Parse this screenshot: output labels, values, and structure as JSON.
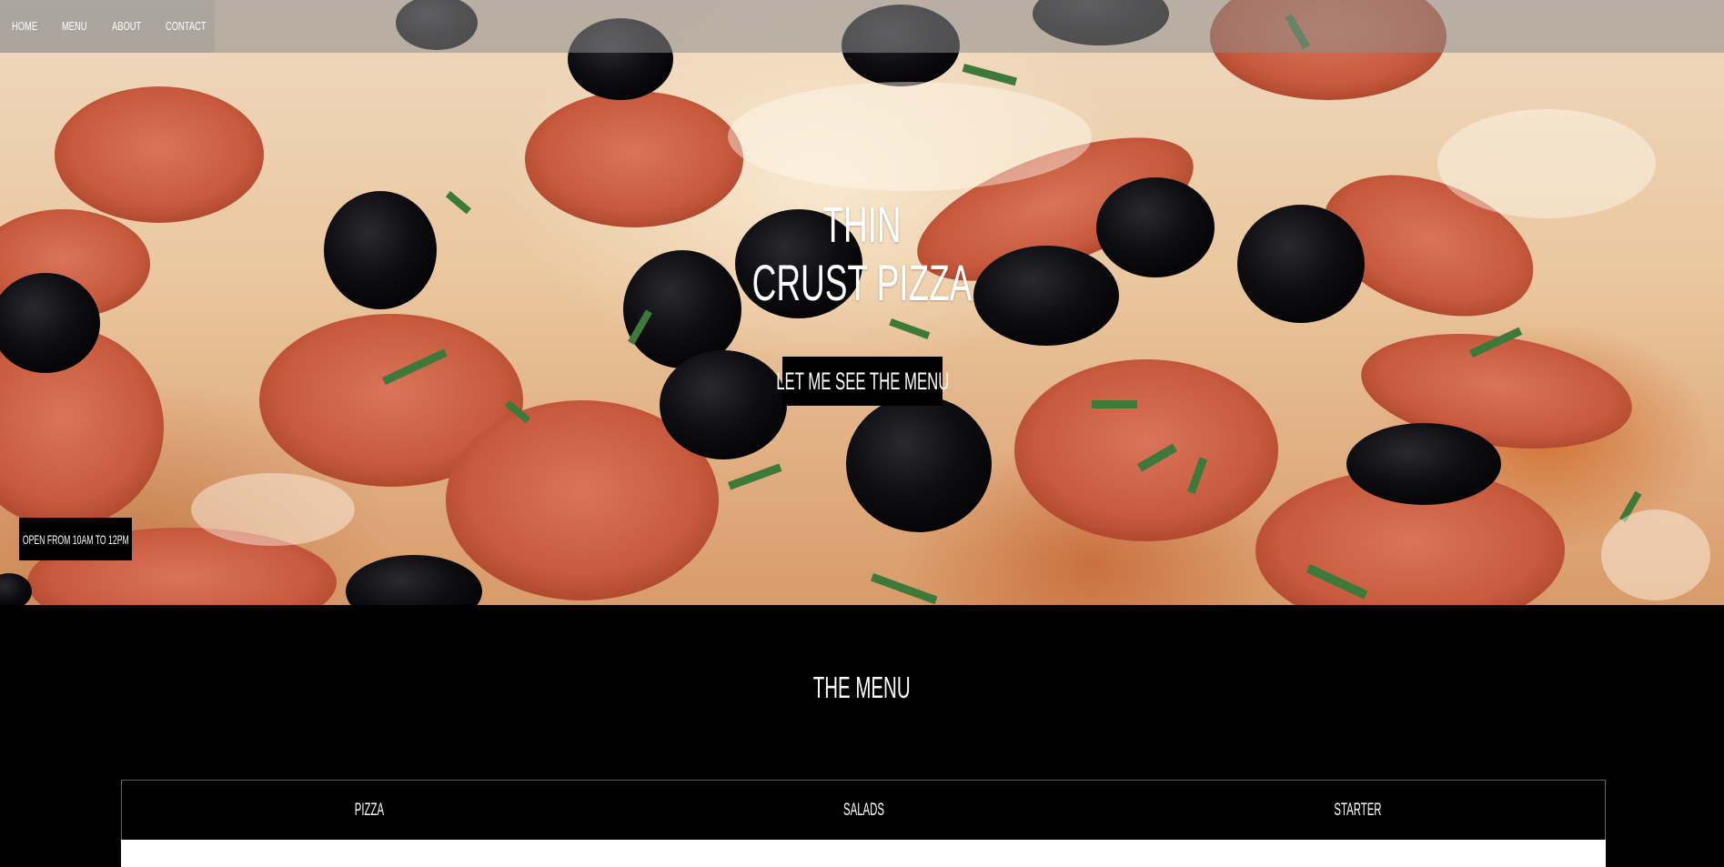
{
  "nav": {
    "items": [
      {
        "label": "Home"
      },
      {
        "label": "Menu"
      },
      {
        "label": "About"
      },
      {
        "label": "Contact"
      }
    ]
  },
  "hero": {
    "title_line1": "Thin",
    "title_line2": "Crust Pizza",
    "cta_label": "Let me see the menu",
    "hours": "Open from 10am to 12pm"
  },
  "menu": {
    "title": "The Menu",
    "tabs": [
      {
        "label": "Pizza"
      },
      {
        "label": "Salads"
      },
      {
        "label": "Starter"
      }
    ]
  },
  "colors": {
    "background": "#000000",
    "text": "#ffffff",
    "nav_overlay": "#8c8c8c"
  }
}
